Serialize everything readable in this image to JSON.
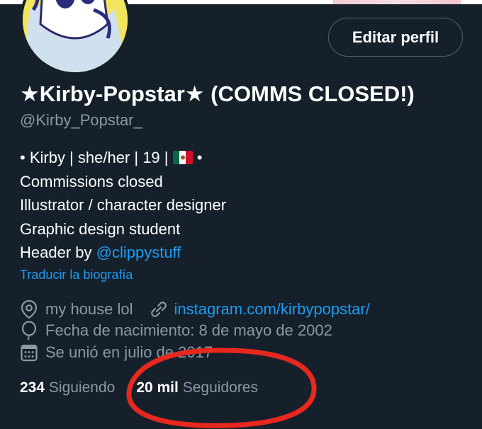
{
  "profile": {
    "name": "★Kirby-Popstar★ (COMMS CLOSED!)",
    "handle": "@Kirby_Popstar_",
    "edit_button": "Editar perfil",
    "bio": {
      "line1_prefix": "• Kirby | she/her | 19 |",
      "line1_suffix": "•",
      "line2": "Commissions closed",
      "line3": "Illustrator / character designer",
      "line4": "Graphic design student",
      "line5_prefix": "Header by ",
      "line5_mention": "@clippystuff"
    },
    "translate_link": "Traducir la biografía",
    "location": "my house lol",
    "website": "instagram.com/kirbypopstar/",
    "birthday": "Fecha de nacimiento: 8 de mayo de 2002",
    "joined": "Se unió en julio de 2017",
    "following_count": "234",
    "following_label": "Siguiendo",
    "followers_count": "20 mil",
    "followers_label": "Seguidores"
  },
  "icons": {
    "location": "location-pin-icon",
    "link": "link-icon",
    "birthday": "balloon-icon",
    "calendar": "calendar-icon",
    "flag": "mexico-flag-icon"
  },
  "colors": {
    "background": "#15202b",
    "text_primary": "#ffffff",
    "text_secondary": "#8b98a5",
    "accent_link": "#1d9bf0",
    "annotation_circle": "#e8281e"
  }
}
